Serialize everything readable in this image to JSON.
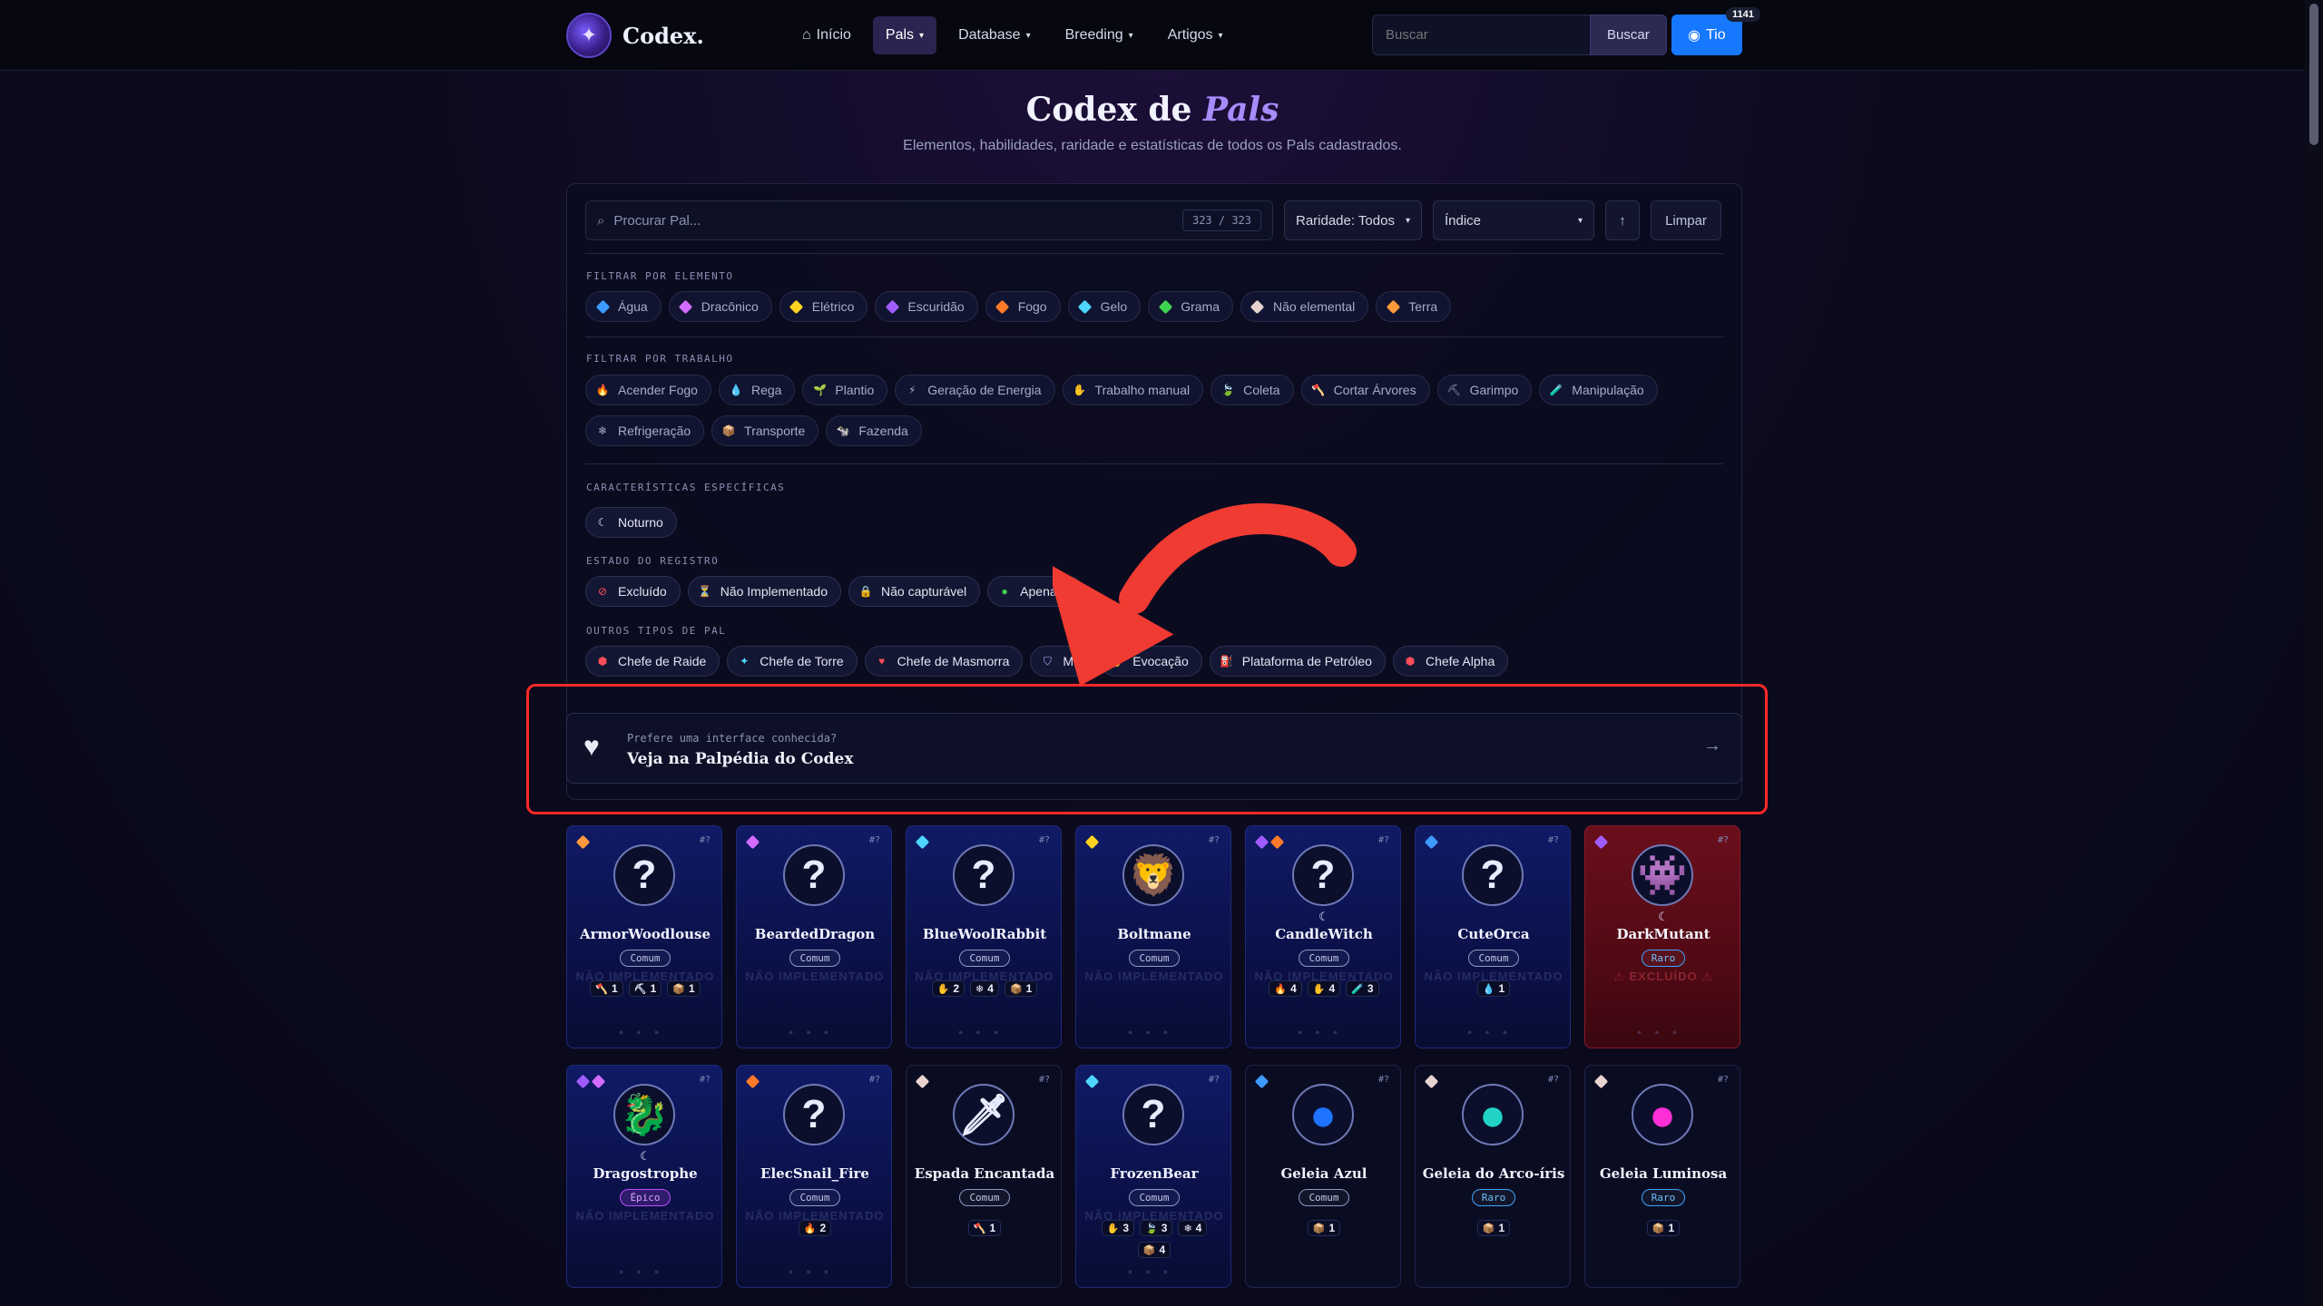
{
  "nav": {
    "brand": "Codex.",
    "links": [
      {
        "label": "Início",
        "icon": "home-icon"
      },
      {
        "label": "Pals",
        "dropdown": true,
        "active": true
      },
      {
        "label": "Database",
        "dropdown": true
      },
      {
        "label": "Breeding",
        "dropdown": true
      },
      {
        "label": "Artigos",
        "dropdown": true
      }
    ],
    "search_placeholder": "Buscar",
    "search_button": "Buscar",
    "user_label": "Tio",
    "user_badge": "1141"
  },
  "header": {
    "title_plain": "Codex de ",
    "title_accent": "Pals",
    "subtitle": "Elementos, habilidades, raridade e estatísticas de todos os Pals cadastrados."
  },
  "toolbar": {
    "search_placeholder": "Procurar Pal...",
    "count": "323 / 323",
    "rarity_select": "Raridade: Todos",
    "sort_select": "Índice",
    "sort_dir": "↑",
    "clear": "Limpar"
  },
  "sections": {
    "element": "FILTRAR POR ELEMENTO",
    "work": "FILTRAR POR TRABALHO",
    "traits": "CARACTERÍSTICAS ESPECÍFICAS",
    "registry": "ESTADO DO REGISTRO",
    "other": "OUTROS TIPOS DE PAL"
  },
  "element_chips": [
    {
      "label": "Água",
      "color": "#3d9bff"
    },
    {
      "label": "Dracônico",
      "color": "#d36bff"
    },
    {
      "label": "Elétrico",
      "color": "#ffd21f"
    },
    {
      "label": "Escuridão",
      "color": "#a05cff"
    },
    {
      "label": "Fogo",
      "color": "#ff7a29"
    },
    {
      "label": "Gelo",
      "color": "#4fd6ff"
    },
    {
      "label": "Grama",
      "color": "#3fd44f"
    },
    {
      "label": "Não elemental",
      "color": "#e8d3cf"
    },
    {
      "label": "Terra",
      "color": "#ff9a3c"
    }
  ],
  "work_chips": [
    {
      "label": "Acender Fogo",
      "icon": "🔥"
    },
    {
      "label": "Rega",
      "icon": "💧"
    },
    {
      "label": "Plantio",
      "icon": "🌱"
    },
    {
      "label": "Geração de Energia",
      "icon": "⚡"
    },
    {
      "label": "Trabalho manual",
      "icon": "✋"
    },
    {
      "label": "Coleta",
      "icon": "🍃"
    },
    {
      "label": "Cortar Árvores",
      "icon": "🪓"
    },
    {
      "label": "Garimpo",
      "icon": "⛏"
    },
    {
      "label": "Manipulação",
      "icon": "🧪"
    },
    {
      "label": "Refrigeração",
      "icon": "❄"
    },
    {
      "label": "Transporte",
      "icon": "📦"
    },
    {
      "label": "Fazenda",
      "icon": "🐄"
    }
  ],
  "trait_chips": [
    {
      "label": "Noturno",
      "icon": "☾"
    }
  ],
  "registry_chips": [
    {
      "label": "Excluído",
      "icon": "⊘",
      "color": "#ff4d5a"
    },
    {
      "label": "Não Implementado",
      "icon": "⏳",
      "color": "#6d8bff"
    },
    {
      "label": "Não capturável",
      "icon": "🔒",
      "color": "#f5c84a"
    },
    {
      "label": "Apenas I",
      "icon": "●",
      "color": "#3fd44f"
    }
  ],
  "other_chips": [
    {
      "label": "Chefe de Raide",
      "icon": "⬢",
      "color": "#ff4d5a"
    },
    {
      "label": "Chefe de Torre",
      "icon": "✦",
      "color": "#4fd6ff"
    },
    {
      "label": "Chefe de Masmorra",
      "icon": "♥",
      "color": "#ff4d5a"
    },
    {
      "label": "Mil",
      "icon": "⛉",
      "color": "#9fb4ff"
    },
    {
      "label": "Evocação",
      "icon": "✋",
      "color": "#f5c84a"
    },
    {
      "label": "Plataforma de Petróleo",
      "icon": "⛽",
      "color": "#9fb4ff"
    },
    {
      "label": "Chefe Alpha",
      "icon": "⬢",
      "color": "#ff4d5a"
    }
  ],
  "callout": {
    "small": "Prefere uma interface conhecida?",
    "big": "Veja na Palpédia do Codex",
    "arrow": "→"
  },
  "cards": [
    {
      "name": "ArmorWoodlouse",
      "num": "#?",
      "rarity": "Comum",
      "elements": [
        "#ff9a3c"
      ],
      "portrait": "?",
      "watermark": "NÃO IMPLEMENTADO",
      "night": false,
      "style": "blue",
      "works": [
        {
          "icon": "🪓",
          "lv": "1"
        },
        {
          "icon": "⛏",
          "lv": "1"
        },
        {
          "icon": "📦",
          "lv": "1"
        }
      ]
    },
    {
      "name": "BeardedDragon",
      "num": "#?",
      "rarity": "Comum",
      "elements": [
        "#d36bff"
      ],
      "portrait": "?",
      "watermark": "NÃO IMPLEMENTADO",
      "night": false,
      "style": "blue",
      "works": []
    },
    {
      "name": "BlueWoolRabbit",
      "num": "#?",
      "rarity": "Comum",
      "elements": [
        "#4fd6ff"
      ],
      "portrait": "?",
      "watermark": "NÃO IMPLEMENTADO",
      "night": false,
      "style": "blue",
      "works": [
        {
          "icon": "✋",
          "lv": "2"
        },
        {
          "icon": "❄",
          "lv": "4"
        },
        {
          "icon": "📦",
          "lv": "1"
        }
      ]
    },
    {
      "name": "Boltmane",
      "num": "#?",
      "rarity": "Comum",
      "elements": [
        "#ffd21f"
      ],
      "portrait": "🦁",
      "watermark": "NÃO IMPLEMENTADO",
      "night": false,
      "style": "blue",
      "works": []
    },
    {
      "name": "CandleWitch",
      "num": "#?",
      "rarity": "Comum",
      "elements": [
        "#a05cff",
        "#ff7a29"
      ],
      "portrait": "?",
      "watermark": "NÃO IMPLEMENTADO",
      "night": true,
      "style": "blue",
      "works": [
        {
          "icon": "🔥",
          "lv": "4"
        },
        {
          "icon": "✋",
          "lv": "4"
        },
        {
          "icon": "🧪",
          "lv": "3"
        }
      ]
    },
    {
      "name": "CuteOrca",
      "num": "#?",
      "rarity": "Comum",
      "elements": [
        "#3d9bff"
      ],
      "portrait": "?",
      "watermark": "NÃO IMPLEMENTADO",
      "night": false,
      "style": "blue",
      "works": [
        {
          "icon": "💧",
          "lv": "1"
        }
      ]
    },
    {
      "name": "DarkMutant",
      "num": "#?",
      "rarity": "Raro",
      "elements": [
        "#a05cff"
      ],
      "portrait": "👾",
      "watermark": "⚠ EXCLUÍDO ⚠",
      "night": true,
      "style": "excluded",
      "works": []
    },
    {
      "name": "Dragostrophe",
      "num": "#?",
      "rarity": "Épico",
      "elements": [
        "#a05cff",
        "#d36bff"
      ],
      "portrait": "🐉",
      "watermark": "NÃO IMPLEMENTADO",
      "night": true,
      "style": "blue",
      "works": []
    },
    {
      "name": "ElecSnail_Fire",
      "num": "#?",
      "rarity": "Comum",
      "elements": [
        "#ff7a29"
      ],
      "portrait": "?",
      "watermark": "NÃO IMPLEMENTADO",
      "night": false,
      "style": "blue",
      "works": [
        {
          "icon": "🔥",
          "lv": "2"
        }
      ]
    },
    {
      "name": "Espada Encantada",
      "num": "#?",
      "rarity": "Comum",
      "elements": [
        "#e8d3cf"
      ],
      "portrait": "🗡",
      "watermark": "",
      "night": false,
      "style": "plain",
      "works": [
        {
          "icon": "🪓",
          "lv": "1"
        }
      ]
    },
    {
      "name": "FrozenBear",
      "num": "#?",
      "rarity": "Comum",
      "elements": [
        "#4fd6ff"
      ],
      "portrait": "?",
      "watermark": "NÃO IMPLEMENTADO",
      "night": false,
      "style": "blue",
      "works": [
        {
          "icon": "✋",
          "lv": "3"
        },
        {
          "icon": "🍃",
          "lv": "3"
        },
        {
          "icon": "❄",
          "lv": "4"
        },
        {
          "icon": "📦",
          "lv": "4"
        }
      ]
    },
    {
      "name": "Geleia Azul",
      "num": "#?",
      "rarity": "Comum",
      "elements": [
        "#3d9bff"
      ],
      "portrait": "●",
      "watermark": "",
      "night": false,
      "style": "plain",
      "works": [
        {
          "icon": "📦",
          "lv": "1"
        }
      ]
    },
    {
      "name": "Geleia do Arco-íris",
      "num": "#?",
      "rarity": "Raro",
      "elements": [
        "#e8d3cf"
      ],
      "portrait": "●",
      "watermark": "",
      "night": false,
      "style": "plain",
      "works": [
        {
          "icon": "📦",
          "lv": "1"
        }
      ]
    },
    {
      "name": "Geleia Luminosa",
      "num": "#?",
      "rarity": "Raro",
      "elements": [
        "#e8d3cf"
      ],
      "portrait": "●",
      "watermark": "",
      "night": false,
      "style": "plain",
      "works": [
        {
          "icon": "📦",
          "lv": "1"
        }
      ]
    }
  ]
}
